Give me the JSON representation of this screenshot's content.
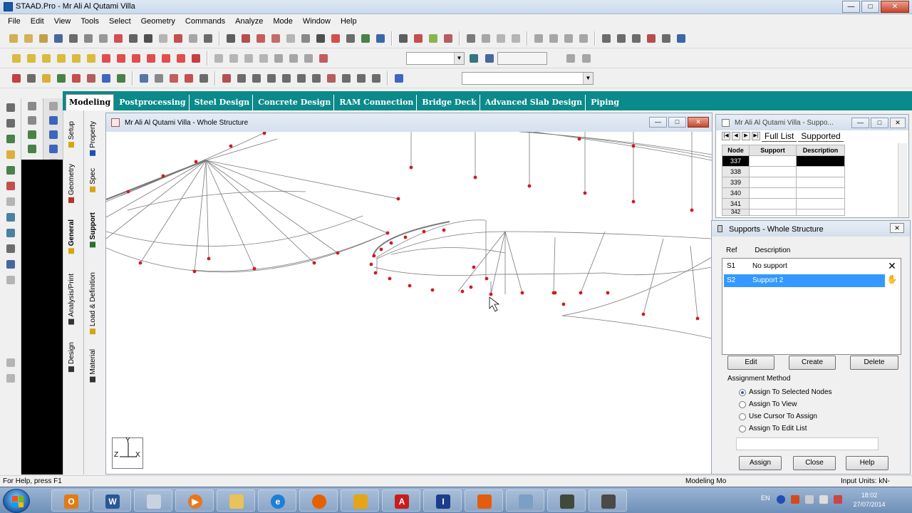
{
  "window": {
    "title": "STAAD.Pro - Mr Ali Al Qutami Villa",
    "min": "—",
    "max": "□",
    "close": "✕"
  },
  "menu": [
    "File",
    "Edit",
    "View",
    "Tools",
    "Select",
    "Geometry",
    "Commands",
    "Analyze",
    "Mode",
    "Window",
    "Help"
  ],
  "mode_tabs": [
    "Modeling",
    "Postprocessing",
    "Steel Design",
    "Concrete Design",
    "RAM Connection",
    "Bridge Deck",
    "Advanced Slab Design",
    "Piping"
  ],
  "active_mode": "Modeling",
  "page_tabs": {
    "outer": [
      "Setup",
      "Geometry",
      "General",
      "Analysis/Print",
      "Design"
    ],
    "inner": [
      "Property",
      "Spec",
      "Support",
      "Load & Definition",
      "Material"
    ]
  },
  "structure_window": {
    "title": "Mr Ali Al Qutami Villa - Whole Structure",
    "axis_y": "Y",
    "axis_z": "Z",
    "axis_x": "X"
  },
  "node_table": {
    "title": "Mr Ali Al Qutami Villa - Suppo...",
    "tabs": [
      "Full List",
      "Supported"
    ],
    "columns": [
      "Node",
      "Support",
      "Description"
    ],
    "rows": [
      "337",
      "338",
      "339",
      "340",
      "341",
      "342"
    ]
  },
  "supports": {
    "title": "Supports - Whole Structure",
    "col_ref": "Ref",
    "col_desc": "Description",
    "rows": [
      {
        "ref": "S1",
        "desc": "No support"
      },
      {
        "ref": "S2",
        "desc": "Support 2"
      }
    ],
    "buttons": {
      "edit": "Edit",
      "create": "Create",
      "delete": "Delete",
      "assign": "Assign",
      "close": "Close",
      "help": "Help"
    },
    "assignment_label": "Assignment Method",
    "methods": [
      "Assign To Selected Nodes",
      "Assign To View",
      "Use Cursor To Assign",
      "Assign To Edit List"
    ],
    "selected_method": 0
  },
  "status": {
    "help": "For Help, press F1",
    "mode": "Modeling Mo",
    "units": "Input Units: kN-"
  },
  "tray": {
    "lang": "EN",
    "time": "18:02",
    "date": "27/07/2014"
  },
  "taskbar_apps": [
    "Outlook",
    "Word",
    "Explorer",
    "Media Player",
    "Folder",
    "Internet Explorer",
    "Firefox",
    "Paint",
    "AutoCAD",
    "STAAD",
    "App",
    "App",
    "App",
    "App"
  ]
}
